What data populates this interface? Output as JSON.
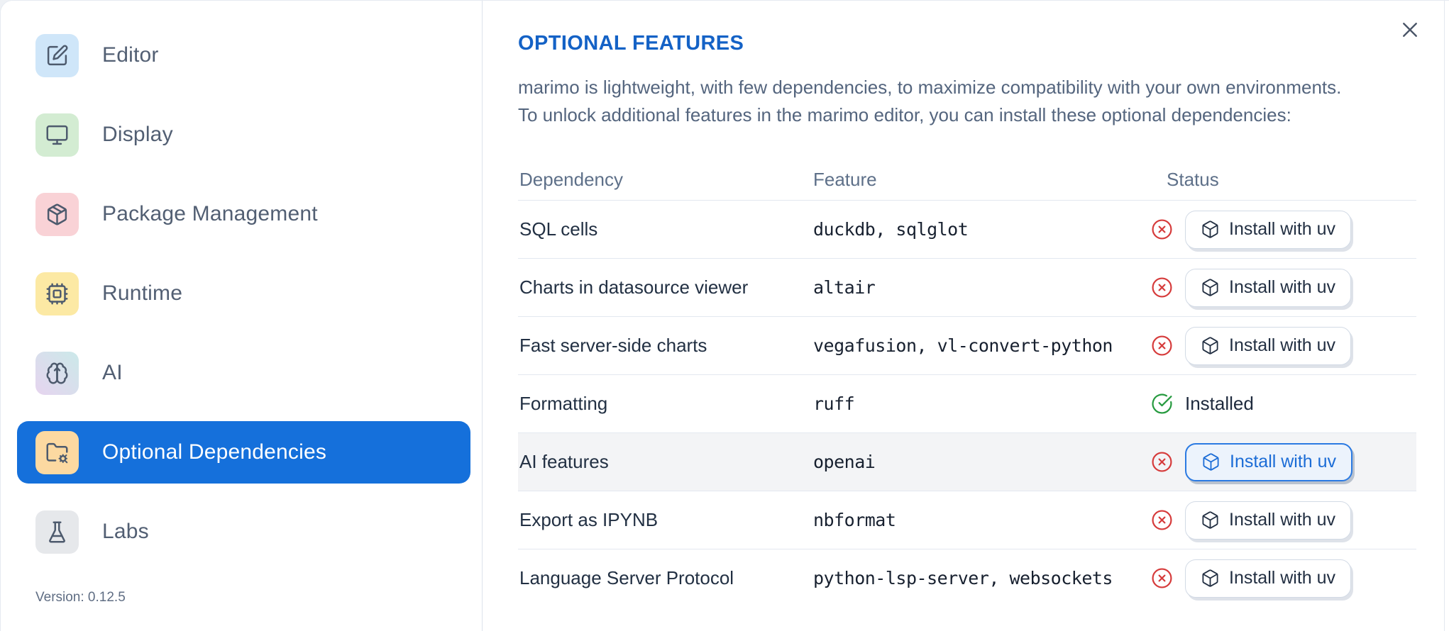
{
  "sidebar": {
    "items": [
      {
        "label": "Editor",
        "icon": "square-pen-icon",
        "icon_bg": "#cfe6f9",
        "selected": false
      },
      {
        "label": "Display",
        "icon": "monitor-icon",
        "icon_bg": "#d3ecd2",
        "selected": false
      },
      {
        "label": "Package Management",
        "icon": "package-icon",
        "icon_bg": "#f9d2d6",
        "selected": false
      },
      {
        "label": "Runtime",
        "icon": "cpu-icon",
        "icon_bg": "#fce9a4",
        "selected": false
      },
      {
        "label": "AI",
        "icon": "brain-icon",
        "icon_bg": "linear-gradient(45deg,#e6d4ef,#cbe9e9)",
        "selected": false
      },
      {
        "label": "Optional Dependencies",
        "icon": "folder-cog-icon",
        "icon_bg": "#fcd9a1",
        "selected": true
      },
      {
        "label": "Labs",
        "icon": "flask-icon",
        "icon_bg": "#e6e8eb",
        "selected": false
      }
    ],
    "version_label": "Version: 0.12.5"
  },
  "dialog": {
    "title": "OPTIONAL FEATURES",
    "description_line1": "marimo is lightweight, with few dependencies, to maximize compatibility with your own environments.",
    "description_line2": "To unlock additional features in the marimo editor, you can install these optional dependencies:",
    "close_icon": "x-icon"
  },
  "table": {
    "columns": [
      "Dependency",
      "Feature",
      "Status"
    ],
    "install_button_label": "Install with uv",
    "install_button_icon": "box-icon",
    "not_installed_icon": "circle-x-icon",
    "installed_icon": "circle-check-icon",
    "installed_label": "Installed",
    "rows": [
      {
        "dependency": "SQL cells",
        "feature": "duckdb, sqlglot",
        "status": "not_installed",
        "highlighted": false,
        "button_focused": false
      },
      {
        "dependency": "Charts in datasource viewer",
        "feature": "altair",
        "status": "not_installed",
        "highlighted": false,
        "button_focused": false
      },
      {
        "dependency": "Fast server-side charts",
        "feature": "vegafusion, vl-convert-python",
        "status": "not_installed",
        "highlighted": false,
        "button_focused": false
      },
      {
        "dependency": "Formatting",
        "feature": "ruff",
        "status": "installed",
        "highlighted": false,
        "button_focused": false
      },
      {
        "dependency": "AI features",
        "feature": "openai",
        "status": "not_installed",
        "highlighted": true,
        "button_focused": true
      },
      {
        "dependency": "Export as IPYNB",
        "feature": "nbformat",
        "status": "not_installed",
        "highlighted": false,
        "button_focused": false
      },
      {
        "dependency": "Language Server Protocol",
        "feature": "python-lsp-server, websockets",
        "status": "not_installed",
        "highlighted": false,
        "button_focused": false
      }
    ]
  },
  "colors": {
    "accent_blue": "#1570DB",
    "title_blue": "#1462C6",
    "status_red": "#d63b3b",
    "status_green": "#269a3f",
    "row_highlight": "#f3f4f6",
    "border": "#e3e8f0"
  }
}
